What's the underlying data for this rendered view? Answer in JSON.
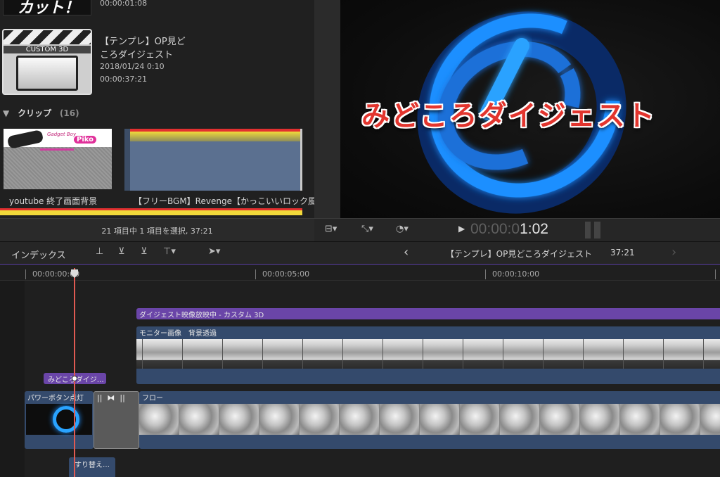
{
  "browser": {
    "top_clip_timecode": "00:00:01:08",
    "thumb_top_text": "カット！",
    "project": {
      "thumb_label": "CUSTOM 3D",
      "title_line1": "【テンプレ】OP見ど",
      "title_line2": "ころダイジェスト",
      "date": "2018/01/24 0:10",
      "duration": "00:00:37:21"
    },
    "clips_section": {
      "label": "クリップ",
      "count": "(16)"
    },
    "clips": [
      {
        "name": "youtube  終了画面背景",
        "thumb_text1": "Gadget Boy",
        "thumb_text2": "Piko"
      },
      {
        "name": "【フリーBGM】Revenge【かっこいいロック風"
      }
    ],
    "status": "21 項目中 1 項目を選択, 37:21"
  },
  "viewer": {
    "title_text": "みどころダイジェスト",
    "timecode_dim": "00:00:0",
    "timecode_bright": "1:02",
    "play_symbol": "▶"
  },
  "toolbar": {
    "index_label": "インデックス",
    "project_name": "【テンプレ】OP見どころダイジェスト",
    "project_duration": "37:21",
    "prev_arrow": "‹",
    "next_arrow": "›"
  },
  "ruler": {
    "ticks": [
      "00:00:00:00",
      "00:00:05:00",
      "00:00:10:00"
    ]
  },
  "timeline": {
    "title_clip": "ダイジェスト映像放映中 - カスタム 3D",
    "monitor_clip": "モニター画像　背景透過",
    "text_clip": "みどころダイジ…",
    "power_clip": "パワーボタン点灯",
    "flow_clip": "フロー",
    "swap_clip": "すり替え…"
  }
}
